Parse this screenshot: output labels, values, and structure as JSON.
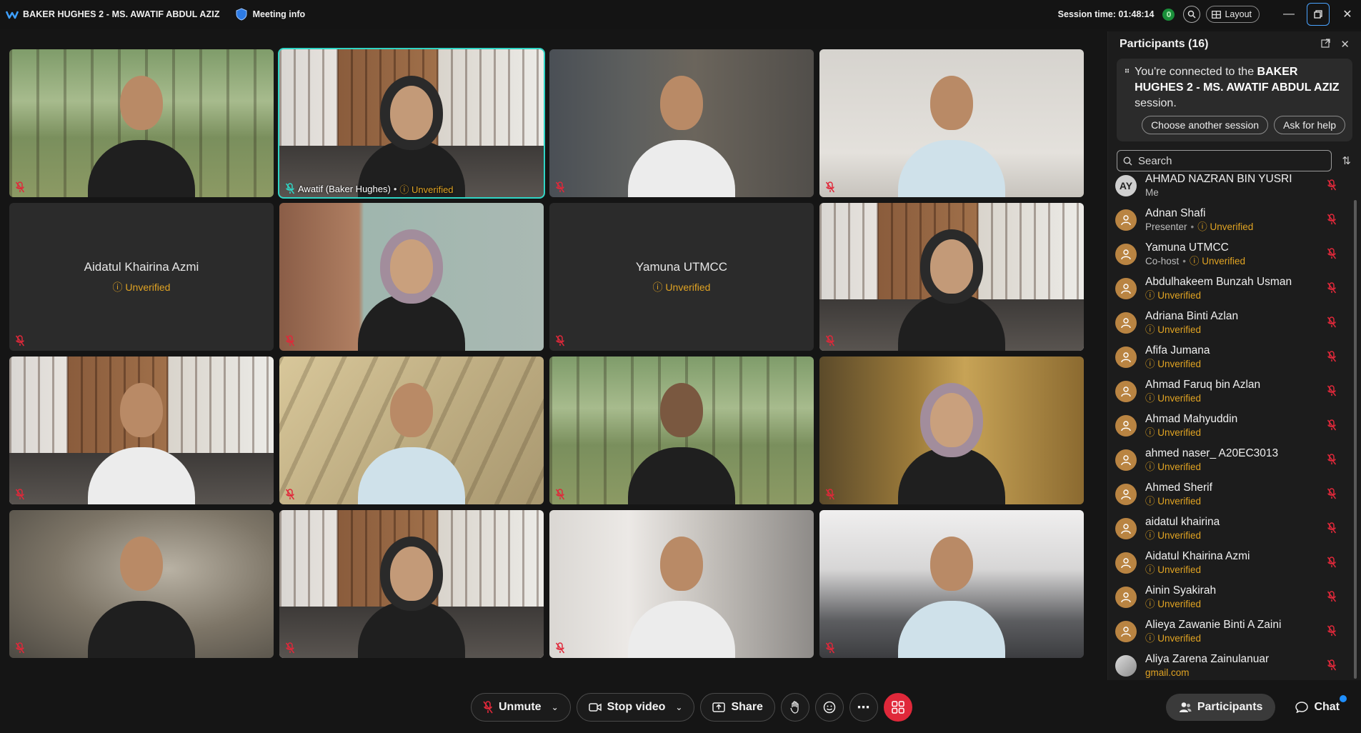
{
  "titlebar": {
    "app_title": "BAKER HUGHES 2 - MS. AWATIF ABDUL AZIZ",
    "meeting_info": "Meeting info",
    "session_time": "Session time: 01:48:14",
    "layout_label": "Layout"
  },
  "tiles": [
    {
      "type": "video",
      "scene": "forest"
    },
    {
      "type": "video",
      "scene": "office",
      "active": true,
      "label": "Awatif (Baker Hughes)",
      "unverified": "Unverified"
    },
    {
      "type": "video",
      "scene": "room-dark"
    },
    {
      "type": "video",
      "scene": "room-white"
    },
    {
      "type": "name",
      "name": "Aidatul Khairina Azmi",
      "unverified": "Unverified"
    },
    {
      "type": "video",
      "scene": "curtain"
    },
    {
      "type": "name",
      "name": "Yamuna UTMCC",
      "unverified": "Unverified"
    },
    {
      "type": "video",
      "scene": "office"
    },
    {
      "type": "video",
      "scene": "office"
    },
    {
      "type": "video",
      "scene": "shadow"
    },
    {
      "type": "video",
      "scene": "forest"
    },
    {
      "type": "video",
      "scene": "gold"
    },
    {
      "type": "video",
      "scene": "blur"
    },
    {
      "type": "video",
      "scene": "office"
    },
    {
      "type": "video",
      "scene": "window"
    },
    {
      "type": "video",
      "scene": "lab"
    }
  ],
  "panel": {
    "title": "Participants (16)",
    "connected_prefix": "You're connected to the ",
    "connected_session": "BAKER HUGHES 2 - MS. AWATIF ABDUL AZIZ",
    "connected_suffix": " session.",
    "choose_session": "Choose another session",
    "ask_help": "Ask for help",
    "search_placeholder": "Search"
  },
  "participants": [
    {
      "name": "AHMAD NAZRAN BIN YUSRI",
      "role": "Me",
      "avatar": "AY"
    },
    {
      "name": "Adnan Shafi",
      "role": "Presenter",
      "unverified": "Unverified"
    },
    {
      "name": "Yamuna UTMCC",
      "role": "Co-host",
      "unverified": "Unverified"
    },
    {
      "name": "Abdulhakeem Bunzah Usman",
      "unverified": "Unverified"
    },
    {
      "name": "Adriana Binti Azlan",
      "unverified": "Unverified"
    },
    {
      "name": "Afifa Jumana",
      "unverified": "Unverified"
    },
    {
      "name": "Ahmad Faruq bin Azlan",
      "unverified": "Unverified"
    },
    {
      "name": "Ahmad Mahyuddin",
      "unverified": "Unverified"
    },
    {
      "name": "ahmed naser_ A20EC3013",
      "unverified": "Unverified"
    },
    {
      "name": "Ahmed Sherif",
      "unverified": "Unverified"
    },
    {
      "name": "aidatul khairina",
      "unverified": "Unverified"
    },
    {
      "name": "Aidatul Khairina Azmi",
      "unverified": "Unverified"
    },
    {
      "name": "Ainin Syakirah",
      "unverified": "Unverified"
    },
    {
      "name": "Alieya Zawanie Binti A Zaini",
      "unverified": "Unverified"
    },
    {
      "name": "Aliya Zarena Zainulanuar",
      "email": "gmail.com",
      "avatar": "img"
    }
  ],
  "controls": {
    "unmute": "Unmute",
    "stop_video": "Stop video",
    "share": "Share",
    "participants": "Participants",
    "chat": "Chat"
  },
  "colors": {
    "accent_teal": "#2fd5c5",
    "unverified": "#e0a323",
    "end_red": "#e0283a",
    "mic_red": "#e0283a"
  }
}
